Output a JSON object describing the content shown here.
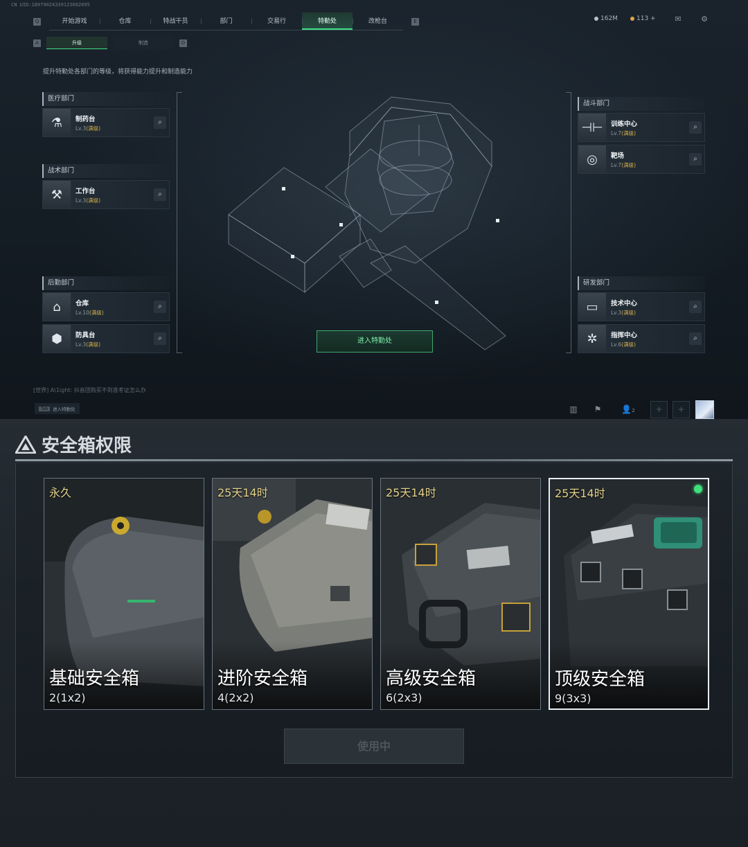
{
  "game": {
    "uid": "CN UID:18979024339123682095",
    "nav_keys": {
      "left": "Q",
      "right": "E"
    },
    "tabs": [
      "开始游戏",
      "仓库",
      "特战干员",
      "部门",
      "交易行",
      "特勤处",
      "改枪台"
    ],
    "active_tab": "特勤处",
    "currency": {
      "coins": "162M",
      "points": "113 +"
    },
    "subtab_keys": {
      "left": "A",
      "right": "D"
    },
    "subtabs": [
      "升级",
      "制造"
    ],
    "active_subtab": "升级",
    "description": "提升特勤处各部门的等级，将获得能力提升和制造能力",
    "departments": {
      "medical": {
        "title": "医疗部门",
        "items": [
          {
            "name": "制药台",
            "level": "Lv.3",
            "status": "(满级)",
            "icon": "microscope-icon"
          }
        ]
      },
      "tactics": {
        "title": "战术部门",
        "items": [
          {
            "name": "工作台",
            "level": "Lv.3",
            "status": "(满级)",
            "icon": "tools-icon"
          }
        ]
      },
      "logistics": {
        "title": "后勤部门",
        "items": [
          {
            "name": "仓库",
            "level": "Lv.10",
            "status": "(满级)",
            "icon": "warehouse-icon"
          },
          {
            "name": "防具台",
            "level": "Lv.3",
            "status": "(满级)",
            "icon": "armor-icon"
          }
        ]
      },
      "combat": {
        "title": "战斗部门",
        "items": [
          {
            "name": "训练中心",
            "level": "Lv.7",
            "status": "(满级)",
            "icon": "dumbbell-icon"
          },
          {
            "name": "靶场",
            "level": "Lv.7",
            "status": "(满级)",
            "icon": "target-icon"
          }
        ]
      },
      "research": {
        "title": "研发部门",
        "items": [
          {
            "name": "技术中心",
            "level": "Lv.3",
            "status": "(满级)",
            "icon": "computer-icon"
          },
          {
            "name": "指挥中心",
            "level": "Lv.6",
            "status": "(满级)",
            "icon": "command-icon"
          }
        ]
      }
    },
    "enter_button": "进入特勤处",
    "chat_line": "[世界] A\\1ight: 抖音团购买不到准考证怎么办",
    "tab_hint": {
      "key": "Tab",
      "label": "进入特勤处"
    },
    "friends_count": "2"
  },
  "safebox": {
    "title": "安全箱权限",
    "cards": [
      {
        "duration": "永久",
        "name": "基础安全箱",
        "size": "2(1x2)",
        "selected": false
      },
      {
        "duration": "25天14时",
        "name": "进阶安全箱",
        "size": "4(2x2)",
        "selected": false
      },
      {
        "duration": "25天14时",
        "name": "高级安全箱",
        "size": "6(2x3)",
        "selected": false
      },
      {
        "duration": "25天14时",
        "name": "顶级安全箱",
        "size": "9(3x3)",
        "selected": true
      }
    ],
    "button_label": "使用中",
    "colors": {
      "accent": "#3ee08a",
      "duration": "#e3d28a",
      "max_level": "#d4b04a"
    }
  }
}
